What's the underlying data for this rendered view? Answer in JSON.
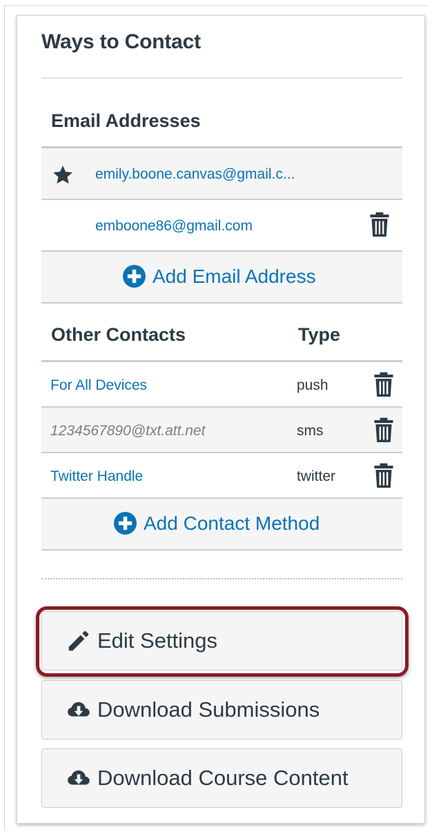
{
  "panel": {
    "title": "Ways to Contact"
  },
  "email_section": {
    "heading": "Email Addresses",
    "rows": [
      {
        "address": "emily.boone.canvas@gmail.c...",
        "icon": "star-icon",
        "primary": true
      },
      {
        "address": "emboone86@gmail.com",
        "icon": "trash-icon",
        "primary": false
      }
    ],
    "add_label": "Add Email Address"
  },
  "contacts_section": {
    "heading": "Other Contacts",
    "type_heading": "Type",
    "rows": [
      {
        "name": "For All Devices",
        "type": "push"
      },
      {
        "name": "1234567890@txt.att.net",
        "type": "sms"
      },
      {
        "name": "Twitter Handle",
        "type": "twitter"
      }
    ],
    "add_label": "Add Contact Method"
  },
  "actions": {
    "edit_settings": "Edit Settings",
    "download_submissions": "Download Submissions",
    "download_course_content": "Download Course Content"
  },
  "colors": {
    "link": "#0a73b5",
    "text": "#2d3b45",
    "highlight": "#8a1c24",
    "row_background": "#f5f5f5"
  }
}
